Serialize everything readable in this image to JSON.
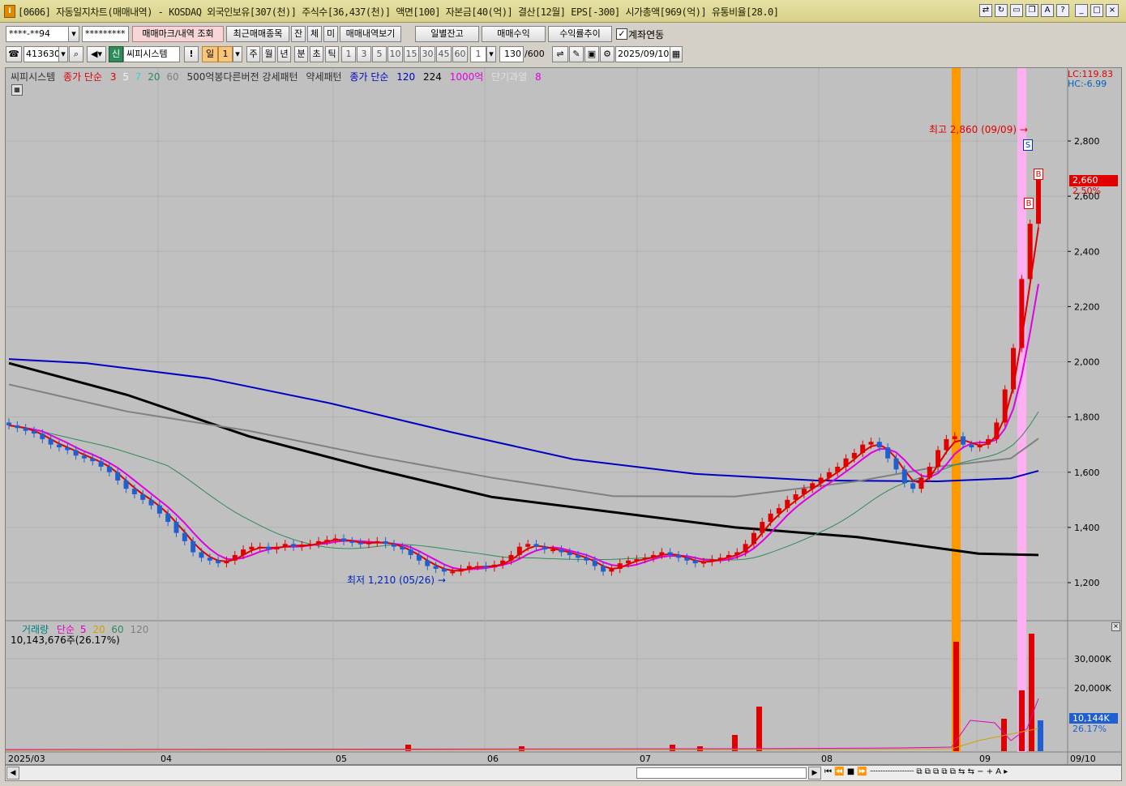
{
  "window": {
    "title": "[0606] 자동일지차트(매매내역) - KOSDAQ 외국인보유[307(천)] 주식수[36,437(천)] 액면[100] 자본금[40(억)] 결산[12월] EPS[-300] 시가총액[969(억)] 유통비율[28.0]",
    "icon_label": "I"
  },
  "toolbar1": {
    "account": "****-**94",
    "password": "*********",
    "btn_trade_marks": "매매마크/내역 조회",
    "btn_recent": "최근매매종목",
    "btn_jan": "잔",
    "btn_che": "체",
    "btn_mi": "미",
    "btn_history": "매매내역보기",
    "btn_daily_balance": "일별잔고",
    "btn_trade_profit": "매매수익",
    "btn_return_trend": "수익률추이",
    "checkbox_label": "계좌연동",
    "checkbox_checked": true
  },
  "toolbar2": {
    "code": "413630",
    "system_label": "씨피시스템",
    "period_selected": "일",
    "period_count": "1",
    "periods": [
      "주",
      "월",
      "년",
      "분",
      "초",
      "틱"
    ],
    "intervals": [
      "1",
      "3",
      "5",
      "10",
      "15",
      "30",
      "45",
      "60"
    ],
    "interval_count": "1",
    "bars_count": "130",
    "bars_total": "/600",
    "date": "2025/09/10"
  },
  "legend_main": {
    "stock_name": "씨피시스템",
    "ma_label": "종가 단순",
    "ma_periods": [
      "3",
      "5",
      "7",
      "20",
      "60"
    ],
    "ma_colors": [
      "#e00000",
      "#f0f0f0",
      "#40d0d0",
      "#2e8b57",
      "#808080"
    ],
    "pattern_strong": "500억봉다른버전 강세패턴",
    "pattern_weak": "약세패턴",
    "ma2_label": "종가 단순",
    "ma2_periods": [
      "120",
      "224"
    ],
    "ma2_colors": [
      "#0000c0",
      "#000000"
    ],
    "cap_label": "1000억",
    "short_term": "단기과열",
    "short_term_value": "8"
  },
  "annotations": {
    "lc": "LC:119.83",
    "hc": "HC:-6.99",
    "high_label": "최고 2,860 (09/09)",
    "low_label": "최저 1,210 (05/26)",
    "current_price": "2,660",
    "current_pct": "2.50%",
    "sell_mark": "S",
    "buy_mark": "B"
  },
  "legend_volume": {
    "label": "거래량",
    "ma_label": "단순",
    "ma_periods": [
      "5",
      "20",
      "60",
      "120"
    ],
    "ma_colors": [
      "#e000c0",
      "#d0a000",
      "#2e8b57",
      "#808080"
    ],
    "volume_text": "10,143,676주(26.17%)",
    "current_volume": "10,144K",
    "current_volume_pct": "26.17%"
  },
  "x_axis_labels": [
    "2025/03",
    "04",
    "05",
    "06",
    "07",
    "08",
    "09",
    "09/10"
  ],
  "price_ticks": [
    "2,800",
    "2,600",
    "2,400",
    "2,200",
    "2,000",
    "1,800",
    "1,600",
    "1,400",
    "1,200"
  ],
  "volume_ticks": [
    "30,000K",
    "20,000K"
  ],
  "colors": {
    "chart_bg": "#c0c0c0",
    "up": "#e00000",
    "down": "#1f5fd0",
    "highlight_orange": "#ff9900",
    "highlight_pink": "#ffb0f0"
  }
}
